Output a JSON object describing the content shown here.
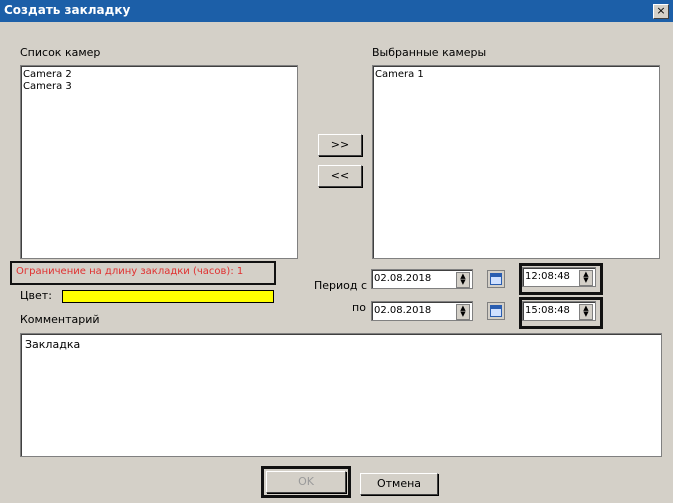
{
  "window": {
    "title": "Создать закладку",
    "close_glyph": "×"
  },
  "cameras": {
    "available_label": "Список камер",
    "available": [
      "Camera 2",
      "Camera 3"
    ],
    "selected_label": "Выбранные камеры",
    "selected": [
      "Camera 1"
    ],
    "add_button": ">>",
    "remove_button": "<<"
  },
  "limit_text": "Ограничение на длину закладки (часов):  1",
  "color": {
    "label": "Цвет:",
    "value": "#ffff00"
  },
  "period": {
    "from_label": "Период с",
    "to_label": "по",
    "from_date": "02.08.2018",
    "from_time": "12:08:48",
    "to_date": "02.08.2018",
    "to_time": "15:08:48",
    "calendar_icon": "calendar-icon"
  },
  "comment": {
    "label": "Комментарий",
    "value": "Закладка"
  },
  "buttons": {
    "ok": "OK",
    "cancel": "Отмена"
  }
}
